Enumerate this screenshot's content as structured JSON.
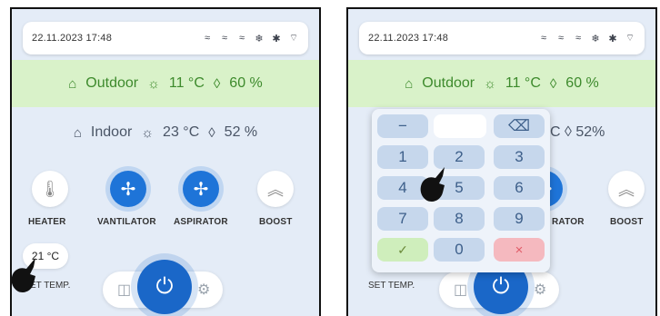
{
  "status": {
    "datetime": "22.11.2023 17:48",
    "icons": [
      "wind-icon",
      "wind-icon",
      "wind-icon",
      "snowflake-icon",
      "bluetooth-icon",
      "wifi-icon"
    ]
  },
  "outdoor": {
    "label": "Outdoor",
    "temp": "11 °C",
    "humidity": "60 %"
  },
  "indoor": {
    "label": "Indoor",
    "temp": "23 °C",
    "humidity": "52 %"
  },
  "modes": {
    "heater": "HEATER",
    "ventilator": "VANTILATOR",
    "aspirator": "ASPIRATOR",
    "boost": "BOOST"
  },
  "set_temp": {
    "value": "21 °C",
    "label": "SET TEMP.",
    "label_partial": "ET TEMP."
  },
  "keypad": {
    "minus": "−",
    "backspace": "⌫",
    "digits": [
      "1",
      "2",
      "3",
      "4",
      "5",
      "6",
      "7",
      "8",
      "9",
      "0"
    ],
    "confirm": "✓",
    "cancel": "×"
  },
  "partial_labels": {
    "indoor_hum": "C ◊ 52%",
    "aspirator": "RATOR"
  },
  "colors": {
    "accent": "#1e74d8",
    "outdoor": "#3d8a2c",
    "confirm": "#cfeebc",
    "cancel": "#f5b9bf"
  }
}
